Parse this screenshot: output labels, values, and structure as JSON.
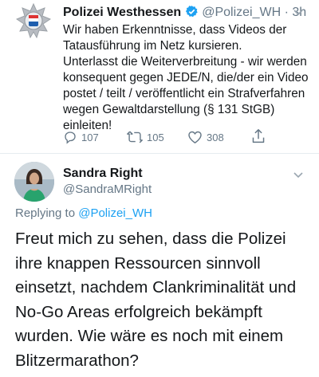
{
  "tweet": {
    "author_name": "Polizei Westhessen",
    "author_handle": "@Polizei_WH",
    "separator": " · ",
    "time": "3h",
    "text": "Wir haben Erkenntnisse, dass Videos der\nTatausführung im Netz kursieren.\nUnterlasst die Weiterverbreitung - wir werden\nkonsequent gegen JEDE/N, die/der ein Video\npostet / teilt / veröffentlicht ein Strafverfahren\nwegen Gewaltdarstellung (§ 131 StGB)\neinleiten!",
    "replies": "107",
    "retweets": "105",
    "likes": "308"
  },
  "reply_tweet": {
    "author_name": "Sandra Right",
    "author_handle": "@SandraMRight",
    "replying_prefix": "Replying to ",
    "replying_to": "@Polizei_WH",
    "text": "Freut mich zu sehen, dass die Polizei\nihre knappen Ressourcen sinnvoll\neinsetzt, nachdem Clankriminalität und\nNo-Go Areas erfolgreich bekämpft\nwurden. Wie wäre es noch mit einem\nBlitzermarathon?"
  },
  "colors": {
    "link": "#1da1f2",
    "secondary": "#657786",
    "text": "#14171a",
    "divider": "#e6ecf0"
  }
}
